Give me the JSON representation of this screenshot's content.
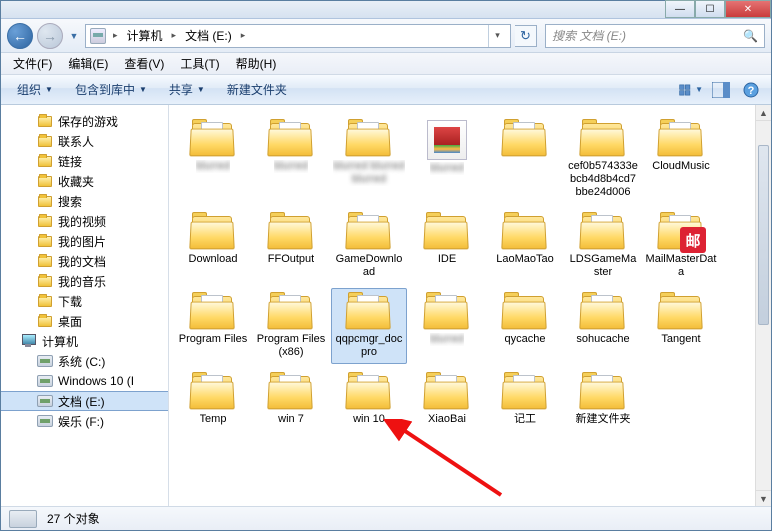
{
  "window": {
    "min": "—",
    "max": "☐",
    "close": "✕"
  },
  "nav": {
    "back_glyph": "←",
    "fwd_glyph": "→",
    "drop_glyph": "▼",
    "refresh_glyph": "↻"
  },
  "address": {
    "crumbs": [
      "计算机",
      "文档 (E:)"
    ],
    "sep": "▸",
    "drop": "▾"
  },
  "search": {
    "placeholder": "搜索 文档 (E:)",
    "icon": "🔍"
  },
  "menubar": [
    "文件(F)",
    "编辑(E)",
    "查看(V)",
    "工具(T)",
    "帮助(H)"
  ],
  "toolbar": {
    "organize": "组织",
    "include": "包含到库中",
    "share": "共享",
    "newfolder": "新建文件夹",
    "dd": "▼"
  },
  "sidebar": {
    "items": [
      {
        "label": "保存的游戏",
        "icon": "folder",
        "indent": true
      },
      {
        "label": "联系人",
        "icon": "folder",
        "indent": true
      },
      {
        "label": "链接",
        "icon": "folder",
        "indent": true
      },
      {
        "label": "收藏夹",
        "icon": "folder",
        "indent": true
      },
      {
        "label": "搜索",
        "icon": "folder",
        "indent": true
      },
      {
        "label": "我的视频",
        "icon": "folder",
        "indent": true
      },
      {
        "label": "我的图片",
        "icon": "folder",
        "indent": true
      },
      {
        "label": "我的文档",
        "icon": "folder",
        "indent": true
      },
      {
        "label": "我的音乐",
        "icon": "folder",
        "indent": true
      },
      {
        "label": "下载",
        "icon": "folder",
        "indent": true
      },
      {
        "label": "桌面",
        "icon": "folder",
        "indent": true
      },
      {
        "label": "计算机",
        "icon": "computer",
        "indent": false
      },
      {
        "label": "系统 (C:)",
        "icon": "drive",
        "indent": true
      },
      {
        "label": "Windows 10 (I",
        "icon": "drive",
        "indent": true
      },
      {
        "label": "文档 (E:)",
        "icon": "drive",
        "indent": true,
        "selected": true
      },
      {
        "label": "娱乐 (F:)",
        "icon": "drive",
        "indent": true
      }
    ]
  },
  "items": [
    {
      "name": "blurred",
      "blur": true,
      "type": "folder-paper"
    },
    {
      "name": "blurred",
      "blur": true,
      "type": "folder-paper"
    },
    {
      "name": "blurred blurred blurred",
      "blur": true,
      "type": "folder-paper"
    },
    {
      "name": "blurred",
      "blur": true,
      "type": "rar"
    },
    {
      "name": "",
      "blur": true,
      "type": "folder-paper"
    },
    {
      "name": "cef0b574333ebcb4d8b4cd7bbe24d006",
      "type": "folder"
    },
    {
      "name": "CloudMusic",
      "type": "folder-paper"
    },
    {
      "name": "Download",
      "type": "folder"
    },
    {
      "name": "FFOutput",
      "type": "folder"
    },
    {
      "name": "GameDownload",
      "type": "folder-paper"
    },
    {
      "name": "IDE",
      "type": "folder"
    },
    {
      "name": "LaoMaoTao",
      "type": "folder"
    },
    {
      "name": "LDSGameMaster",
      "type": "folder-paper"
    },
    {
      "name": "MailMasterData",
      "type": "mail"
    },
    {
      "name": "Program Files",
      "type": "folder-paper"
    },
    {
      "name": "Program Files (x86)",
      "type": "folder-paper"
    },
    {
      "name": "qqpcmgr_docpro",
      "type": "folder-paper",
      "selected": true
    },
    {
      "name": "blurred",
      "blur": true,
      "type": "folder-paper"
    },
    {
      "name": "qycache",
      "type": "folder"
    },
    {
      "name": "sohucache",
      "type": "folder-paper"
    },
    {
      "name": "Tangent",
      "type": "folder"
    },
    {
      "name": "Temp",
      "type": "folder-paper"
    },
    {
      "name": "win 7",
      "type": "folder-paper"
    },
    {
      "name": "win 10",
      "type": "folder-paper"
    },
    {
      "name": "XiaoBai",
      "type": "folder-paper"
    },
    {
      "name": "记工",
      "type": "folder-paper"
    },
    {
      "name": "新建文件夹",
      "type": "folder-paper"
    }
  ],
  "status": {
    "count": "27 个对象"
  },
  "mail_glyph": "邮"
}
